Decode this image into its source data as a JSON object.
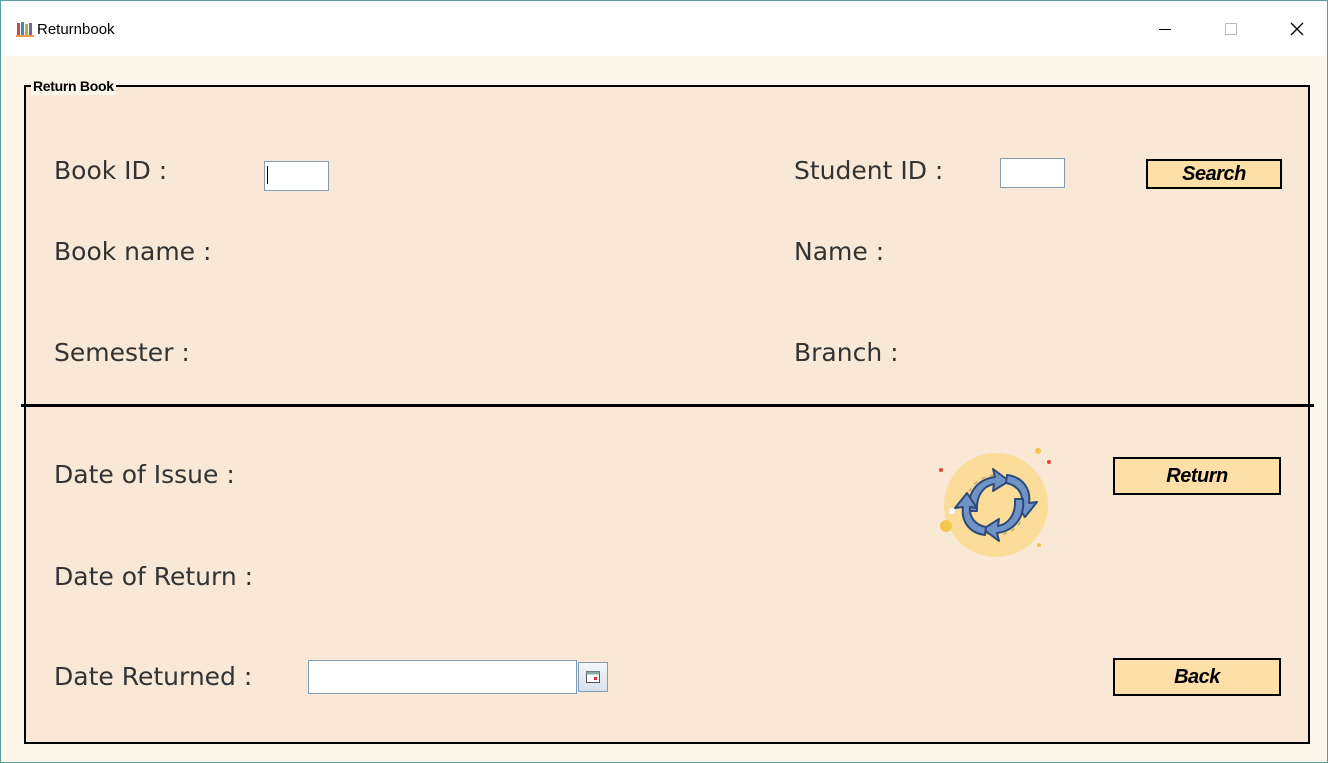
{
  "window": {
    "title": "Returnbook",
    "icon": "books-icon",
    "controls": [
      "minimize",
      "maximize",
      "close"
    ]
  },
  "group": {
    "title": "Return Book"
  },
  "labels": {
    "book_id": "Book ID :",
    "student_id": "Student ID :",
    "book_name": "Book name :",
    "name": "Name :",
    "semester": "Semester :",
    "branch": "Branch :",
    "date_of_issue": "Date of Issue :",
    "date_of_return": "Date of Return :",
    "date_returned": "Date Returned :"
  },
  "inputs": {
    "book_id": "",
    "student_id": "",
    "date_returned": ""
  },
  "buttons": {
    "search": "Search",
    "return": "Return",
    "back": "Back"
  },
  "icons": {
    "calendar": "calendar-icon",
    "illustration": "return-cycle-icon"
  },
  "colors": {
    "panel_bg": "#f8e8d5",
    "button_bg": "#ffdfa8",
    "border": "#000000"
  }
}
